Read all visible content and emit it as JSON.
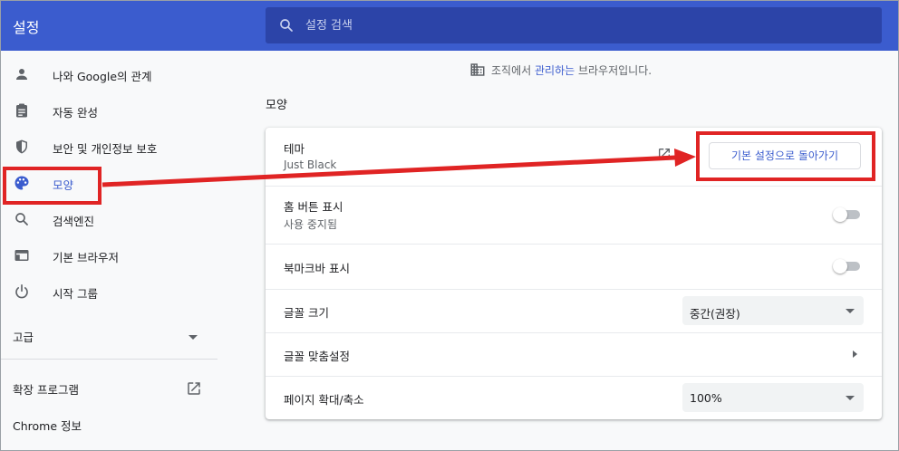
{
  "header": {
    "title": "설정",
    "search_placeholder": "설정 검색"
  },
  "sidebar": {
    "items": [
      {
        "label": "나와 Google의 관계",
        "icon": "person-icon"
      },
      {
        "label": "자동 완성",
        "icon": "clipboard-icon"
      },
      {
        "label": "보안 및 개인정보 보호",
        "icon": "shield-icon"
      },
      {
        "label": "모양",
        "icon": "palette-icon",
        "active": true
      },
      {
        "label": "검색엔진",
        "icon": "search-icon"
      },
      {
        "label": "기본 브라우저",
        "icon": "browser-window-icon"
      },
      {
        "label": "시작 그룹",
        "icon": "power-icon"
      }
    ],
    "advanced_label": "고급",
    "extensions_label": "확장 프로그램",
    "about_label": "Chrome 정보"
  },
  "main": {
    "managed_text_prefix": "조직에서 ",
    "managed_link": "관리하는",
    "managed_text_suffix": " 브라우저입니다.",
    "section_title": "모양",
    "theme": {
      "label": "테마",
      "value": "Just Black",
      "reset_button": "기본 설정으로 돌아가기"
    },
    "home_button": {
      "label": "홈 버튼 표시",
      "status": "사용 중지됨",
      "enabled": false
    },
    "bookmarks_bar": {
      "label": "북마크바 표시",
      "enabled": false
    },
    "font_size": {
      "label": "글꼴 크기",
      "selected": "중간(권장)"
    },
    "custom_fonts": {
      "label": "글꼴 맞춤설정"
    },
    "page_zoom": {
      "label": "페이지 확대/축소",
      "selected": "100%"
    }
  },
  "colors": {
    "accent": "#3b5cce",
    "annotation": "#e02424"
  }
}
